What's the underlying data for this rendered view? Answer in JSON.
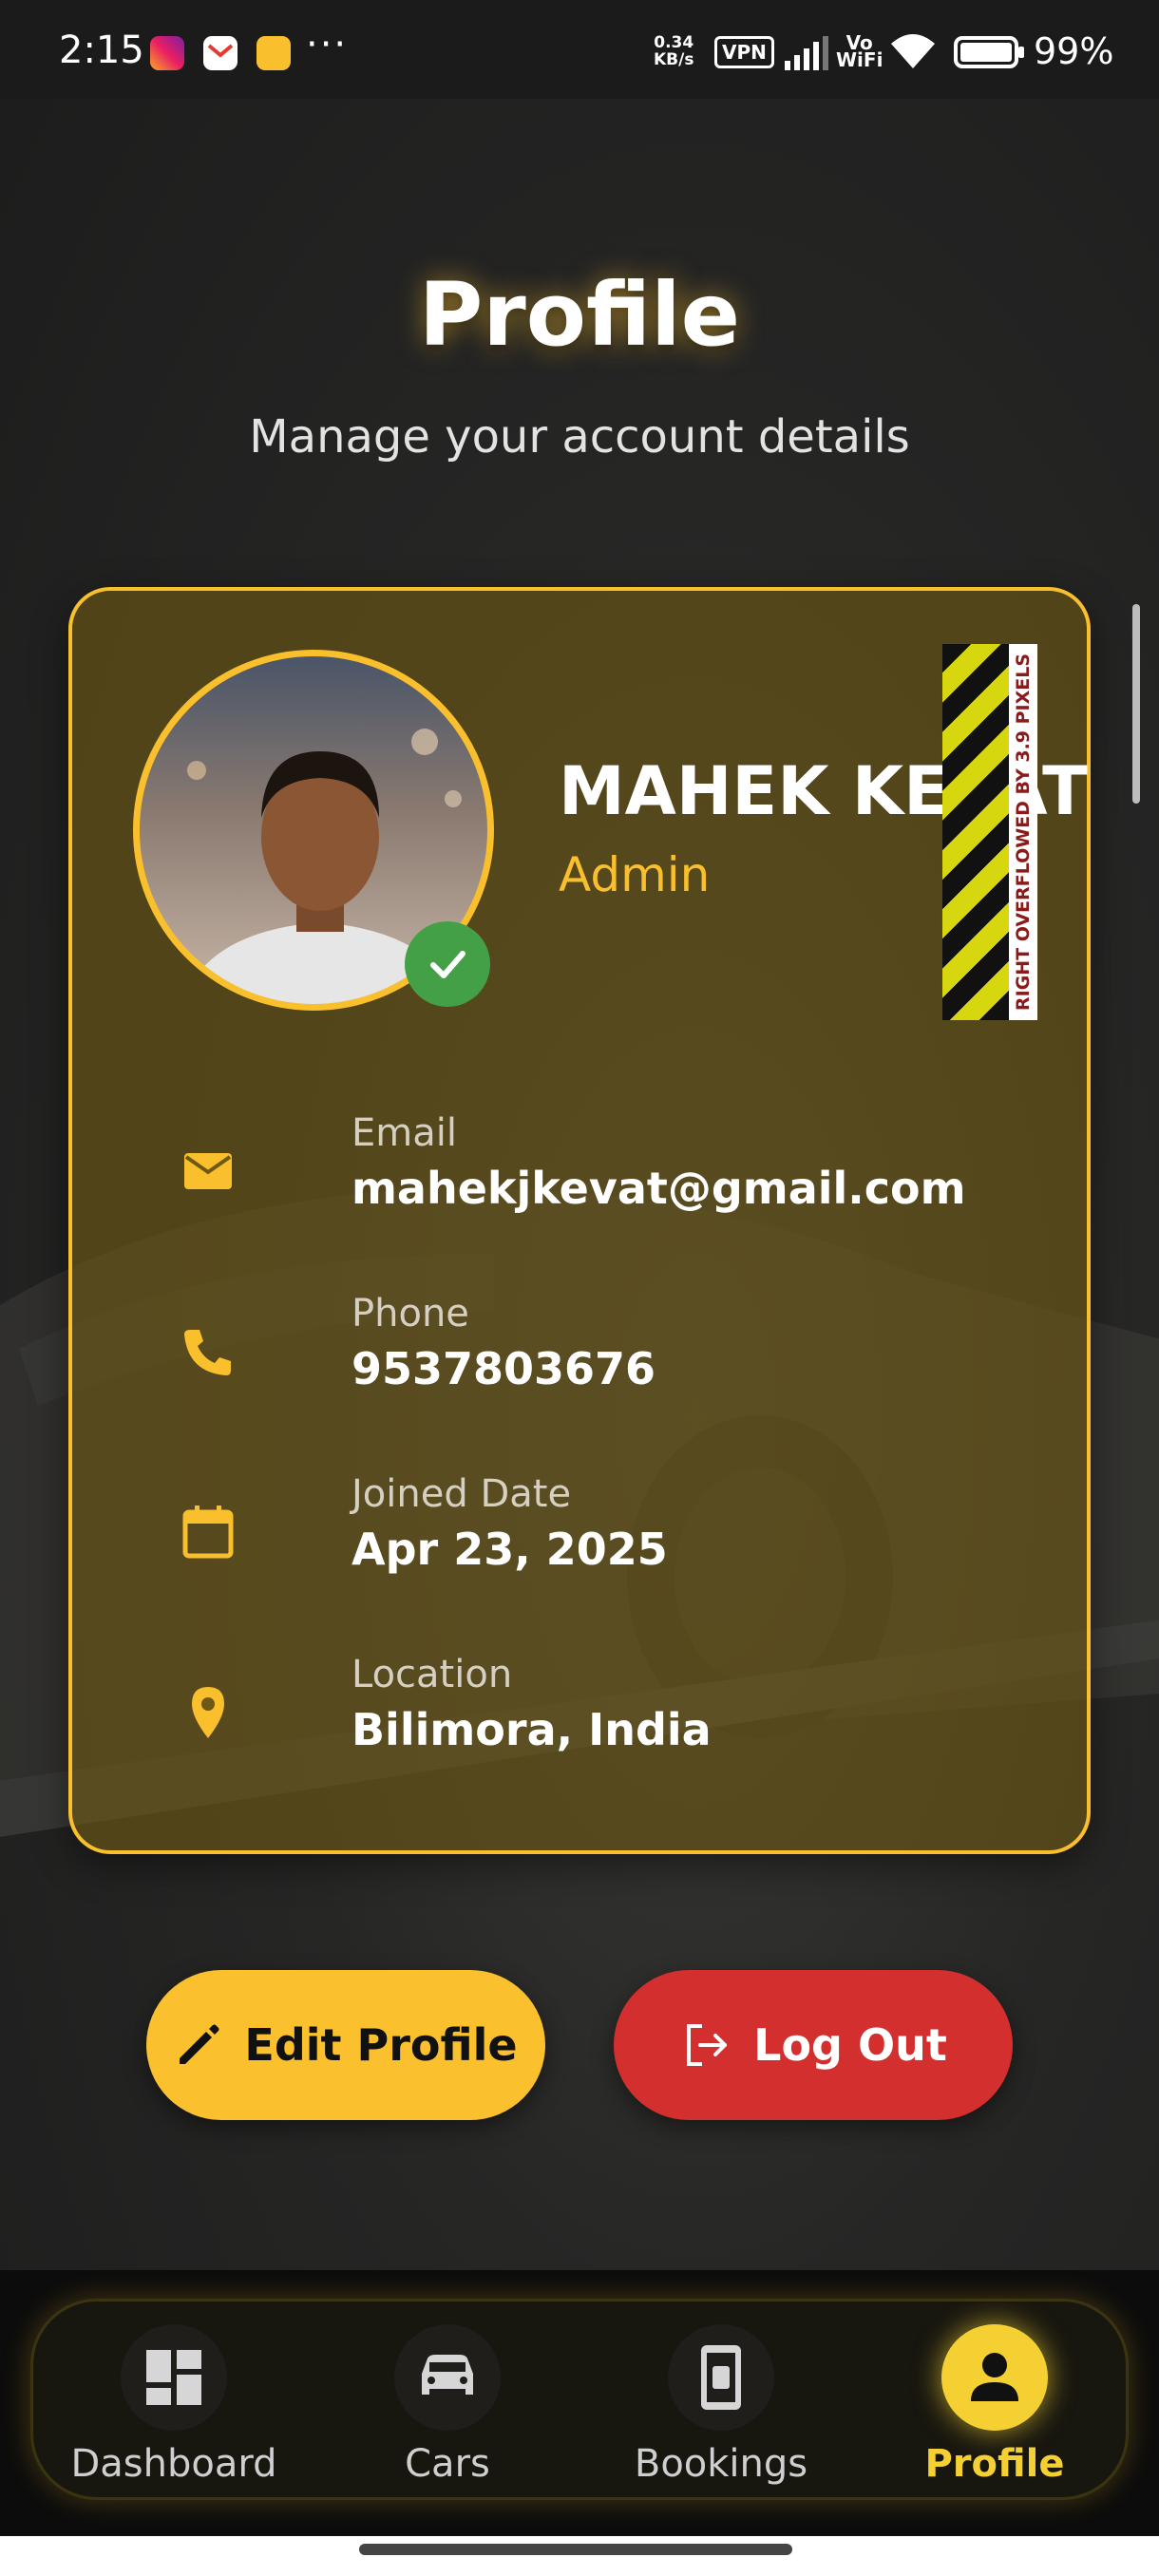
{
  "status_bar": {
    "time": "2:15",
    "dots": "···",
    "net_speed_top": "0.34",
    "net_speed_bottom": "KB/s",
    "vpn": "VPN",
    "vowifi_top": "Vo",
    "vowifi_bottom": "WiFi",
    "battery": "99%"
  },
  "header": {
    "title": "Profile",
    "subtitle": "Manage your account details"
  },
  "profile": {
    "name": "MAHEK KEVAT",
    "role": "Admin",
    "overflow_warning": "RIGHT OVERFLOWED BY 3.9 PIXELS",
    "fields": [
      {
        "label": "Email",
        "value": "mahekjkevat@gmail.com",
        "icon": "mail-icon"
      },
      {
        "label": "Phone",
        "value": "9537803676",
        "icon": "phone-icon"
      },
      {
        "label": "Joined Date",
        "value": "Apr 23, 2025",
        "icon": "calendar-icon"
      },
      {
        "label": "Location",
        "value": "Bilimora, India",
        "icon": "location-pin-icon"
      }
    ]
  },
  "actions": {
    "edit_label": "Edit Profile",
    "logout_label": "Log Out"
  },
  "nav": {
    "items": [
      {
        "label": "Dashboard",
        "icon": "dashboard-icon"
      },
      {
        "label": "Cars",
        "icon": "car-icon"
      },
      {
        "label": "Bookings",
        "icon": "bookings-icon"
      },
      {
        "label": "Profile",
        "icon": "person-icon",
        "active": true
      }
    ]
  },
  "colors": {
    "accent": "#f9bf2c",
    "danger": "#d32f2f",
    "success": "#43a047"
  }
}
